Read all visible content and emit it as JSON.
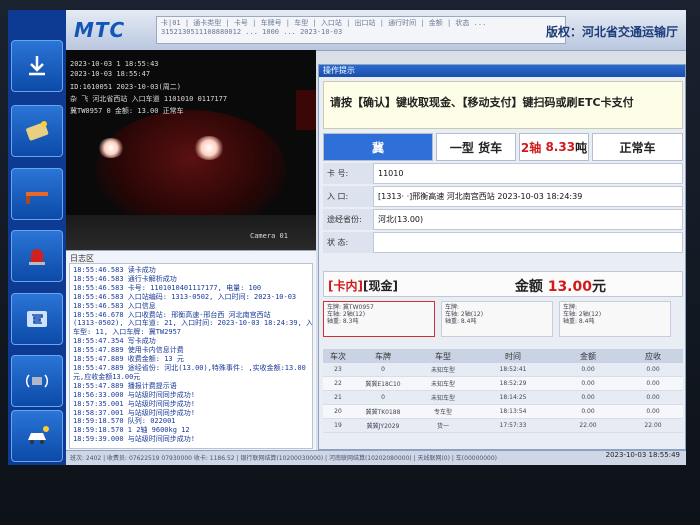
{
  "app": {
    "logo": "MTC",
    "agency": "版权：河北省交通运输厅",
    "ticker": "卡|01 | 通卡类型 | 卡号 | 车牌号 | 车型 | 入口站 | 出口站 | 通行时间 | 金额 | 状态 ... 3152130511108880012 ... 1000 ... 2023-10-03"
  },
  "camera": {
    "overlay_time": "2023-10-03 1 18:55:43",
    "overlay_lines": [
      "2023-10-03 18:55:47",
      "ID:1610051  2023-10-03(周二)",
      "杂 飞 河北省西站  入口车道 1101010 0117177",
      "冀TW0957 0   金额: 13.00 正常车"
    ],
    "camera_label": "Camera 01"
  },
  "log": {
    "title": "日志区",
    "lines": [
      "18:55:46.583 读卡成功",
      "18:55:46.583 通行卡解析成功",
      "18:55:46.583 卡号: 1101010401117177, 电量: 100",
      "18:55:46.583 入口站编码: 1313-0502, 入口时间: 2023-10-03",
      "18:55:46.583 入口信息",
      "18:55:46.678 入口收费站: 邢衡高速-邢台西 河北南宫西站",
      "(1313-0502), 入口车道: 21, 入口时间: 2023-10-03 18:24:39, 入口",
      "车型: 11, 入口车牌: 冀TW2957",
      "18:55:47.354 写卡成功",
      "18:55:47.889 使用卡内信息计费",
      "18:55:47.889 收费金额: 13 元",
      "18:55:47.889 途经省份: 河北(13.00),特殊事件: ,实收金额:13.00",
      "元,应收金额13.00元",
      "18:55:47.889 播报计费提示语",
      "18:56:33.000 与站级时间同步成功!",
      "18:57:35.001 与站级时间同步成功!",
      "18:58:37.001 与站级时间同步成功!",
      "18:59:18.570 队列: 022001",
      "18:59:18.570 1  2轴   9600kg  12",
      "18:59:39.000 与站级时间同步成功!"
    ]
  },
  "operation": {
    "title": "操作提示",
    "prompt": "请按【确认】键收取现金、【移动支付】键扫码或刷ETC卡支付",
    "vehicle": {
      "plate": "冀",
      "class": "一型 货车",
      "axles": "2轴",
      "weight": "8.33",
      "weight_unit": "吨",
      "status": "正常车"
    },
    "info": {
      "card_label": "卡 号:",
      "card_value": "11010",
      "entry_label": "入 口:",
      "entry_value": "[1313·  ·]邢衡高速 河北南宫西站 2023-10-03 18:24:39",
      "province_label": "途经省份:",
      "province_value": "河北(13.00)",
      "state_label": "状 态:",
      "state_value": ""
    },
    "fee": {
      "mode_tag": "[卡内]",
      "mode_pay": "[现金]",
      "amount_label": "金额",
      "amount": "13.00",
      "unit": "元"
    },
    "axle_cards": [
      {
        "title": "车牌: 冀TW0957",
        "line2": "车轴: 2轴(12)",
        "line3": "轴重: 8.3吨"
      },
      {
        "title": "车牌: ",
        "line2": "车轴: 2轴(12)",
        "line3": "轴重: 8.4吨"
      },
      {
        "title": "车牌: ",
        "line2": "车轴: 2轴(12)",
        "line3": "轴重: 8.4吨"
      }
    ]
  },
  "history": {
    "headers": [
      "车次",
      "车牌",
      "车型",
      "时间",
      "金额",
      "应收"
    ],
    "rows": [
      [
        "23",
        "0",
        "未知车型",
        "18:52:41",
        "0.00",
        "0.00"
      ],
      [
        "22",
        "冀冀E18C10",
        "未知车型",
        "18:52:29",
        "0.00",
        "0.00"
      ],
      [
        "21",
        "0",
        "未知车型",
        "18:14:25",
        "0.00",
        "0.00"
      ],
      [
        "20",
        "冀冀TK0188",
        "专车型",
        "18:13:54",
        "0.00",
        "0.00"
      ],
      [
        "19",
        "冀冀JY2029",
        "货一",
        "17:57:33",
        "22.00",
        "22.00"
      ]
    ]
  },
  "statusbar": {
    "text": "班次: 2402 | 收费员: 07622519  07930000 收卡: 1186.52 | 银行联网结算(10200030000) | 河南联网结算(10202080000) | 天线联网(0) | 车(00000000)",
    "time": "2023-10-03 18:55:49"
  }
}
